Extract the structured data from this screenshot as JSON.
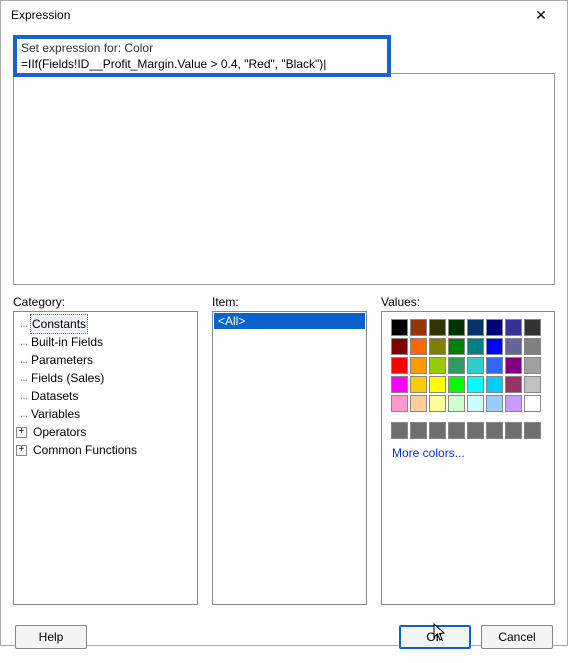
{
  "window": {
    "title": "Expression"
  },
  "header": {
    "set_label": "Set expression for: Color",
    "expression": "=IIf(Fields!ID__Profit_Margin.Value > 0.4, \"Red\", \"Black\")|"
  },
  "labels": {
    "category": "Category:",
    "item": "Item:",
    "values": "Values:"
  },
  "category_tree": {
    "items": [
      {
        "label": "Constants",
        "selected": true,
        "expandable": false
      },
      {
        "label": "Built-in Fields",
        "selected": false,
        "expandable": false
      },
      {
        "label": "Parameters",
        "selected": false,
        "expandable": false
      },
      {
        "label": "Fields (Sales)",
        "selected": false,
        "expandable": false
      },
      {
        "label": "Datasets",
        "selected": false,
        "expandable": false
      },
      {
        "label": "Variables",
        "selected": false,
        "expandable": false
      },
      {
        "label": "Operators",
        "selected": false,
        "expandable": true
      },
      {
        "label": "Common Functions",
        "selected": false,
        "expandable": true
      }
    ]
  },
  "item_list": {
    "selected_label": "<All>"
  },
  "values_panel": {
    "more_colors": "More colors...",
    "colors": {
      "rows_small": [
        [
          "#000000",
          "#993300",
          "#333300",
          "#003300",
          "#003366",
          "#000080",
          "#333399",
          "#333333"
        ],
        [
          "#800000",
          "#ff6600",
          "#808000",
          "#008000",
          "#008080",
          "#0000ff",
          "#666699",
          "#808080"
        ],
        [
          "#ff0000",
          "#ff9900",
          "#99cc00",
          "#339966",
          "#33cccc",
          "#3366ff",
          "#800080",
          "#a0a0a0"
        ],
        [
          "#ff00ff",
          "#ffcc00",
          "#ffff00",
          "#00ff00",
          "#00ffff",
          "#00ccff",
          "#993366",
          "#c0c0c0"
        ],
        [
          "#ff99cc",
          "#ffcc99",
          "#ffff99",
          "#ccffcc",
          "#ccffff",
          "#99ccff",
          "#cc99ff",
          "#ffffff"
        ]
      ],
      "row_large": [
        "#6f6f6f",
        "#6f6f6f",
        "#6f6f6f",
        "#6f6f6f",
        "#6f6f6f",
        "#6f6f6f",
        "#6f6f6f",
        "#6f6f6f"
      ]
    }
  },
  "buttons": {
    "help": "Help",
    "ok": "OK",
    "cancel": "Cancel"
  }
}
